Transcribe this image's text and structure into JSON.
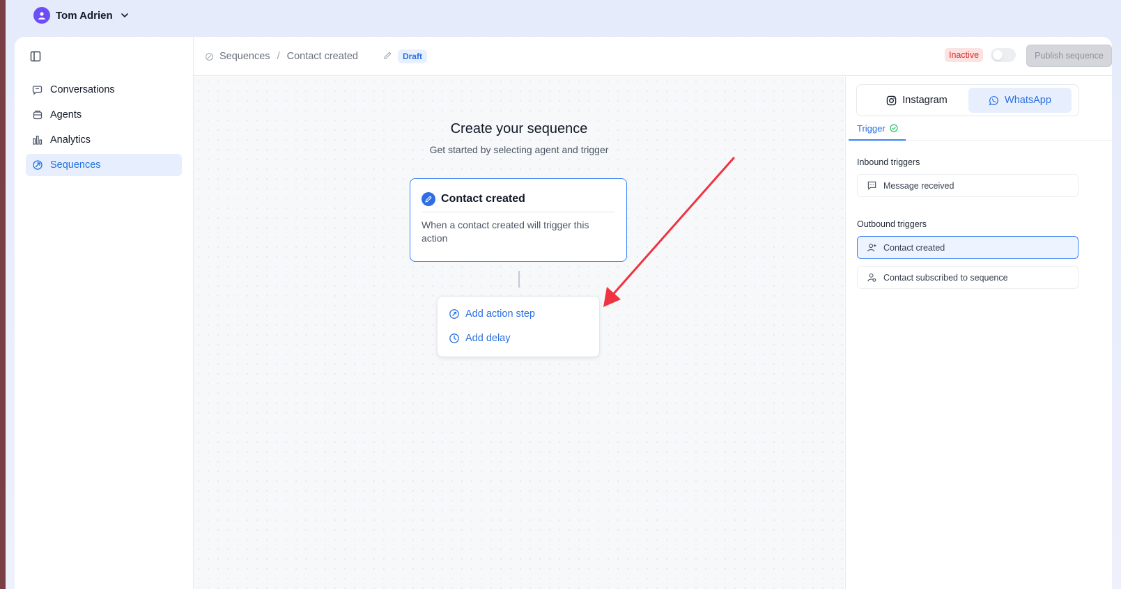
{
  "user": {
    "name": "Tom Adrien"
  },
  "sidebar": {
    "items": [
      {
        "label": "Conversations",
        "icon": "chat-icon"
      },
      {
        "label": "Agents",
        "icon": "agent-icon"
      },
      {
        "label": "Analytics",
        "icon": "bar-chart-icon"
      },
      {
        "label": "Sequences",
        "icon": "leaf-icon",
        "active": true
      }
    ]
  },
  "header": {
    "breadcrumb_root": "Sequences",
    "breadcrumb_separator": "/",
    "breadcrumb_current": "Contact created",
    "draft_label": "Draft",
    "status_label": "Inactive",
    "toggle_on": false,
    "publish_label": "Publish sequence"
  },
  "canvas": {
    "title": "Create your sequence",
    "subtitle": "Get started by selecting agent and trigger",
    "trigger_card": {
      "title": "Contact created",
      "description": "When a contact created will trigger this action"
    },
    "actions": {
      "add_action_step": "Add action step",
      "add_delay": "Add delay"
    }
  },
  "right_panel": {
    "channels": [
      {
        "label": "Instagram",
        "icon": "instagram-icon",
        "active": false
      },
      {
        "label": "WhatsApp",
        "icon": "whatsapp-icon",
        "active": true
      }
    ],
    "subtab": "Trigger",
    "inbound_label": "Inbound triggers",
    "inbound": [
      {
        "label": "Message received",
        "icon": "message-icon"
      }
    ],
    "outbound_label": "Outbound triggers",
    "outbound": [
      {
        "label": "Contact created",
        "icon": "user-plus-icon",
        "selected": true
      },
      {
        "label": "Contact subscribed to sequence",
        "icon": "user-subscribe-icon",
        "selected": false
      }
    ]
  },
  "colors": {
    "accent": "#2a6fe0",
    "annotation_arrow": "#ef3340",
    "inactive": "#dc2626"
  }
}
